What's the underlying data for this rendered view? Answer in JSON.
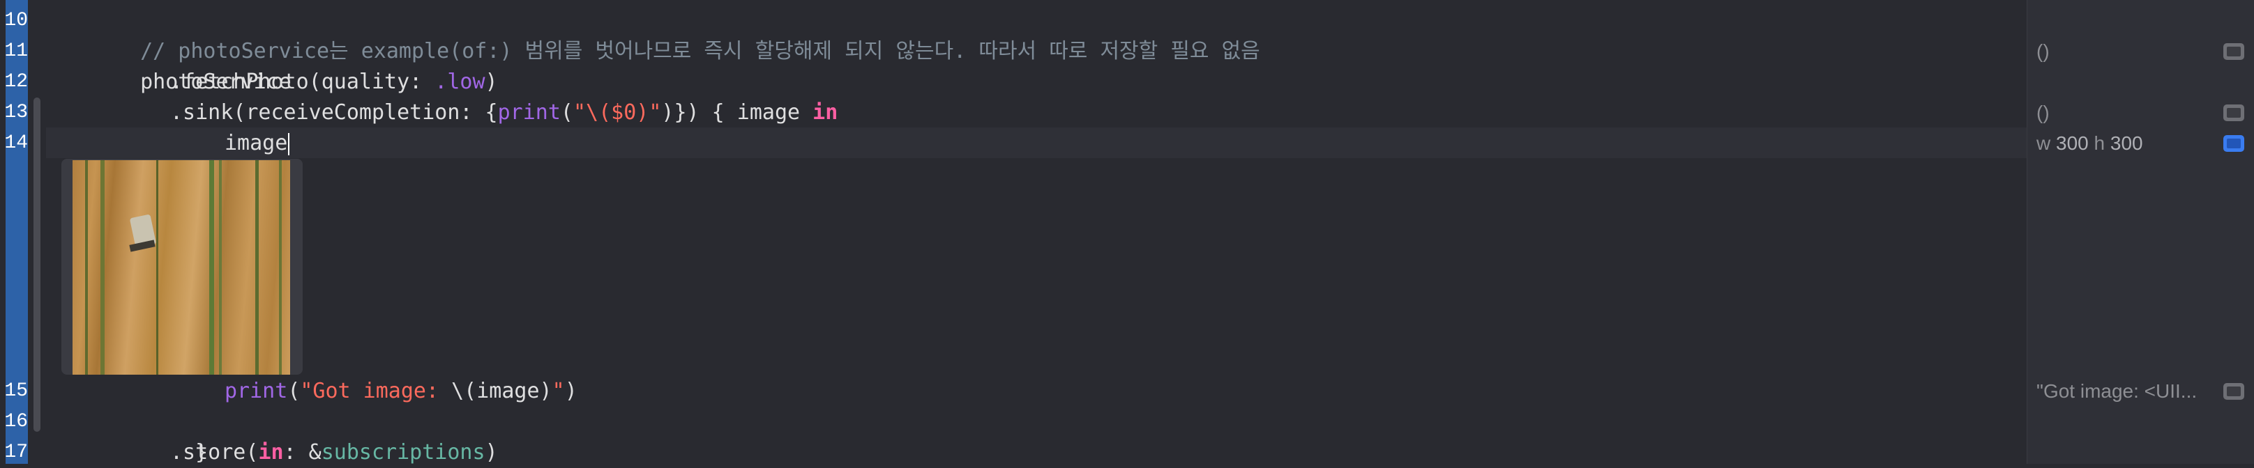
{
  "line_numbers": [
    "10",
    "11",
    "12",
    "13",
    "14",
    "15",
    "16",
    "17"
  ],
  "code": {
    "line10_comment": "// photoService는 example(of:) 범위를 벗어나므로 즉시 할당해제 되지 않는다. 따라서 따로 저장할 필요 없음",
    "line11_text": "photoService",
    "line12_prefix": ".fetchPhoto(quality: ",
    "line12_member": ".low",
    "line12_suffix": ")",
    "line13_prefix": ".sink(receiveCompletion: {",
    "line13_fn": "print",
    "line13_str": "\"\\($0)\"",
    "line13_mid": ")}) { image ",
    "line13_kw": "in",
    "line14_text": "image",
    "line15_fn": "print",
    "line15_paren": "(",
    "line15_str1": "\"Got image: ",
    "line15_interp": "\\(image)",
    "line15_str2": "\"",
    "line15_close": ")",
    "line16_text": "}",
    "line17_prefix": ".store(",
    "line17_kw": "in",
    "line17_mid": ": &",
    "line17_prop": "subscriptions",
    "line17_suffix": ")"
  },
  "image_preview": {
    "subject": "aerial-wheat-field-harvester"
  },
  "results": {
    "line11_value": "()",
    "line13_value": "()",
    "line14_w_label": "w",
    "line14_w_value": "300",
    "line14_h_label": "h",
    "line14_h_value": "300",
    "line15_value": "\"Got image: <UII..."
  },
  "colors": {
    "background": "#292a30",
    "run_strip": "#2d62a8",
    "comment": "#7f8c98",
    "keyword": "#fc5fa3",
    "function": "#a167e6",
    "string": "#fc6a5d",
    "property": "#67b7a4",
    "results_active_button": "#3a7cf0"
  }
}
